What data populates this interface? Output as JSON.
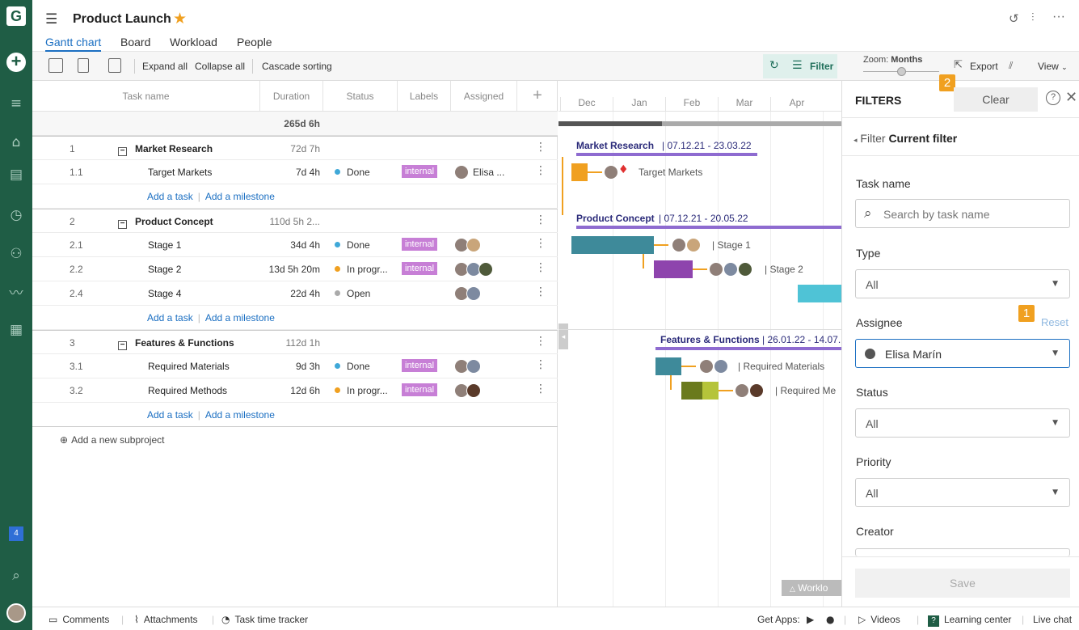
{
  "app": {
    "logo": "G",
    "notif_count": "4"
  },
  "project": {
    "title": "Product Launch",
    "tabs": [
      "Gantt chart",
      "Board",
      "Workload",
      "People"
    ]
  },
  "toolbar": {
    "expand": "Expand all",
    "collapse": "Collapse all",
    "cascade": "Cascade sorting",
    "filter": "Filter",
    "zoom_label": "Zoom:",
    "zoom_value": "Months",
    "export": "Export",
    "view": "View"
  },
  "grid": {
    "headers": {
      "task": "Task name",
      "duration": "Duration",
      "status": "Status",
      "labels": "Labels",
      "assigned": "Assigned"
    },
    "total": "265d 6h",
    "add_task": "Add a task",
    "add_milestone": "Add a milestone",
    "add_subproject": "Add a new subproject",
    "rows": [
      {
        "num": "1",
        "name": "Market Research",
        "dur": "72d 7h",
        "group": true
      },
      {
        "num": "1.1",
        "name": "Target Markets",
        "dur": "7d 4h",
        "status": "Done",
        "label": "internal",
        "assignee": "Elisa ..."
      },
      {
        "num": "2",
        "name": "Product Concept",
        "dur": "110d 5h 2...",
        "group": true
      },
      {
        "num": "2.1",
        "name": "Stage 1",
        "dur": "34d 4h",
        "status": "Done",
        "label": "internal"
      },
      {
        "num": "2.2",
        "name": "Stage 2",
        "dur": "13d 5h 20m",
        "status": "In progr...",
        "label": "internal"
      },
      {
        "num": "2.4",
        "name": "Stage 4",
        "dur": "22d 4h",
        "status": "Open"
      },
      {
        "num": "3",
        "name": "Features & Functions",
        "dur": "112d 1h",
        "group": true
      },
      {
        "num": "3.1",
        "name": "Required Materials",
        "dur": "9d 3h",
        "status": "Done",
        "label": "internal"
      },
      {
        "num": "3.2",
        "name": "Required Methods",
        "dur": "12d 6h",
        "status": "In progr...",
        "label": "internal"
      }
    ]
  },
  "gantt": {
    "months": [
      "Dec",
      "Jan",
      "Feb",
      "Mar",
      "Apr"
    ],
    "market_title": "Market Research",
    "market_dates": "07.12.21 - 23.03.22",
    "target_markets": "Target Markets",
    "concept_title": "Product Concept",
    "concept_dates": "07.12.21 - 20.05.22",
    "stage1": "Stage 1",
    "stage2": "Stage 2",
    "features_title": "Features & Functions",
    "features_dates": "26.01.22 - 14.07.",
    "req_materials": "Required Materials",
    "req_methods": "Required Me",
    "workload": "Worklo"
  },
  "filters": {
    "title": "FILTERS",
    "clear": "Clear",
    "back": "Filter",
    "current": "Current filter",
    "task_name": "Task name",
    "search_placeholder": "Search by task name",
    "type": "Type",
    "type_value": "All",
    "assignee": "Assignee",
    "reset": "Reset",
    "assignee_value": "Elisa Marín",
    "status": "Status",
    "status_value": "All",
    "priority": "Priority",
    "priority_value": "All",
    "creator": "Creator",
    "save": "Save",
    "badge1": "1",
    "badge2": "2"
  },
  "footer": {
    "comments": "Comments",
    "attachments": "Attachments",
    "tracker": "Task time tracker",
    "get_apps": "Get Apps:",
    "videos": "Videos",
    "learning": "Learning center",
    "live_chat": "Live chat"
  },
  "colors": {
    "rail": "#1f5d45",
    "accent": "#1b6fc2",
    "teal": "#3e8a9a",
    "purple": "#8e44ad",
    "orange": "#f0a020",
    "olive": "#6a7a1d"
  }
}
